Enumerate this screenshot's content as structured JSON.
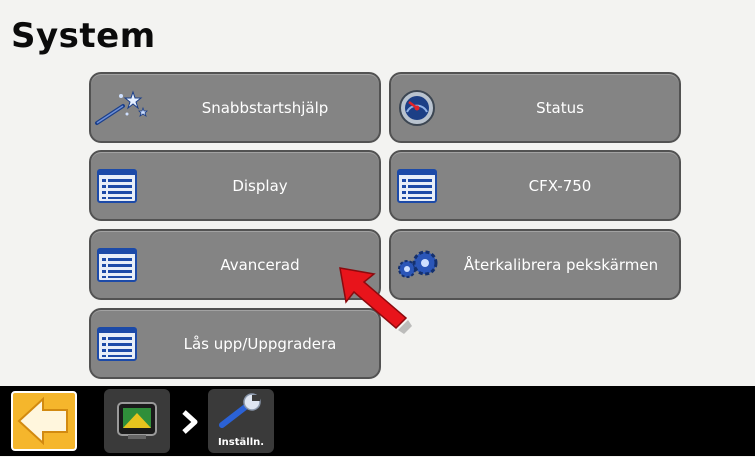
{
  "page": {
    "title": "System"
  },
  "menu": {
    "quickstart": {
      "label": "Snabbstartshjälp",
      "icon": "magic-wand-icon"
    },
    "status": {
      "label": "Status",
      "icon": "gauge-icon"
    },
    "display": {
      "label": "Display",
      "icon": "list-document-icon"
    },
    "cfx750": {
      "label": "CFX-750",
      "icon": "list-document-icon"
    },
    "advanced": {
      "label": "Avancerad",
      "icon": "list-document-icon"
    },
    "recalibrate": {
      "label": "Återkalibrera pekskärmen",
      "icon": "gears-icon"
    },
    "unlock": {
      "label": "Lås upp/Uppgradera",
      "icon": "list-document-icon"
    }
  },
  "bottom_bar": {
    "back_icon": "back-arrow-icon",
    "display_icon": "display-device-icon",
    "settings_label": "Inställn.",
    "settings_icon": "wrench-icon"
  },
  "colors": {
    "button": "#848484",
    "back_button": "#f5b62c",
    "bar": "#000000",
    "annotation_arrow": "#e8141b"
  }
}
